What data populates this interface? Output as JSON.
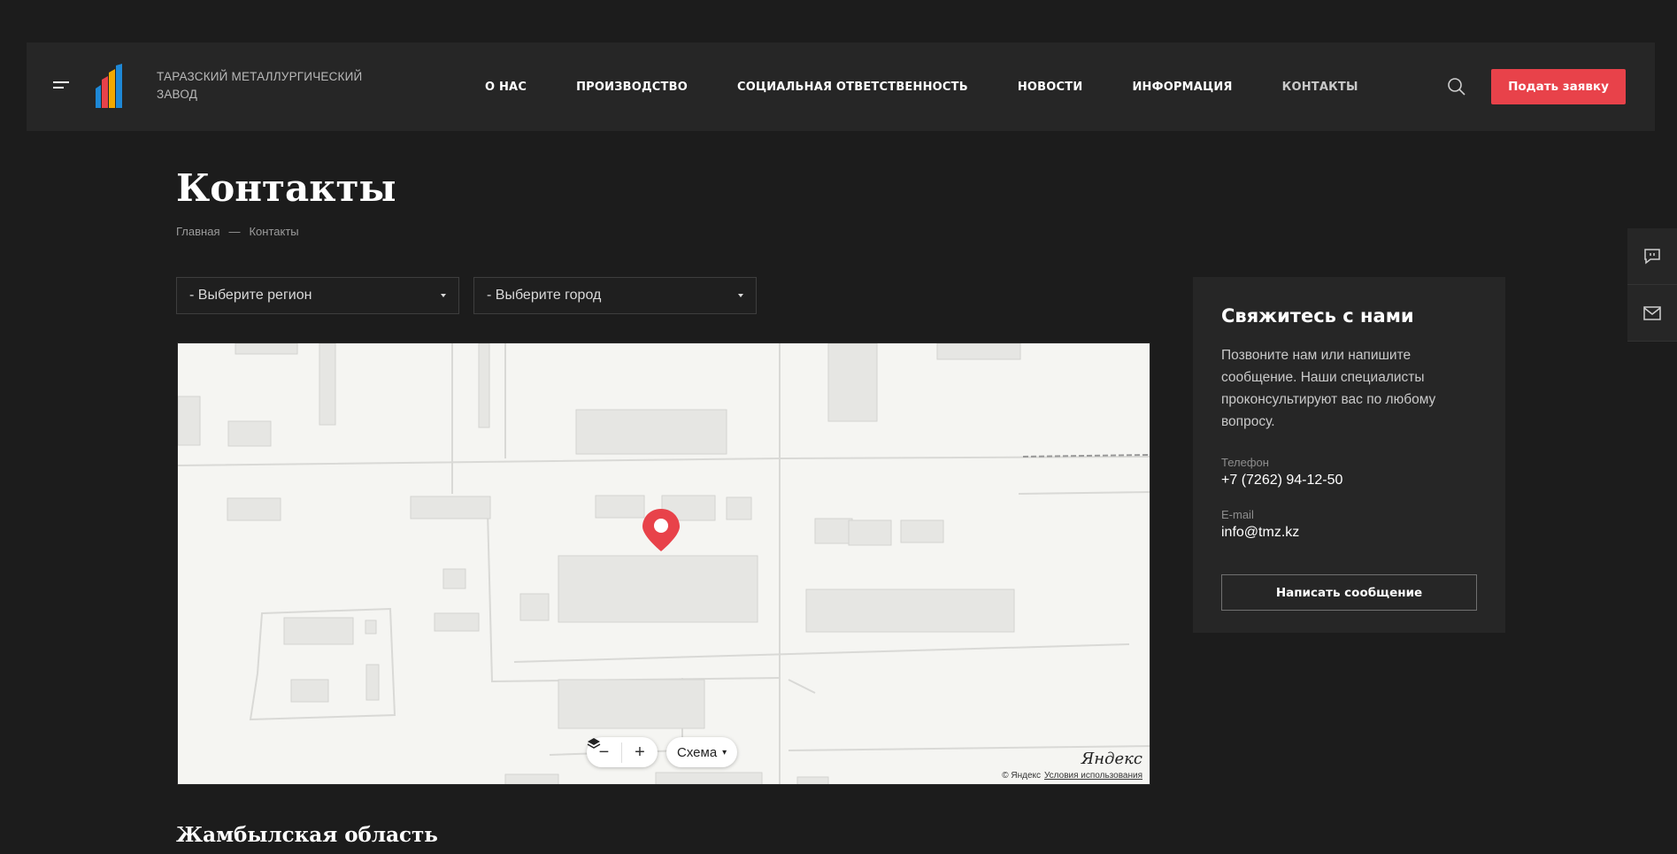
{
  "header": {
    "brand": "ТАРАЗСКИЙ МЕТАЛЛУРГИЧЕСКИЙ ЗАВОД",
    "nav": [
      "О НАС",
      "ПРОИЗВОДСТВО",
      "СОЦИАЛЬНАЯ ОТВЕТСТВЕННОСТЬ",
      "НОВОСТИ",
      "ИНФОРМАЦИЯ",
      "КОНТАКТЫ"
    ],
    "cta_label": "Подать заявку",
    "accent": "#e8424a"
  },
  "page": {
    "title": "Контакты",
    "breadcrumb": [
      "Главная",
      "Контакты"
    ],
    "breadcrumb_sep": "—"
  },
  "filters": {
    "region": "- Выберите регион",
    "city": "- Выберите город"
  },
  "map": {
    "scheme_label": "Схема",
    "provider": "Яндекс",
    "copyright": "© Яндекс",
    "terms_link": "Условия использования"
  },
  "region_heading": "Жамбылская область",
  "card": {
    "title": "Свяжитесь с нами",
    "text": "Позвоните нам или напишите сообщение. Наши специалисты проконсультируют вас по любому вопросу.",
    "phone_label": "Телефон",
    "phone": "+7 (7262) 94-12-50",
    "email_label": "E-mail",
    "email": "info@tmz.kz",
    "button": "Написать сообщение"
  }
}
